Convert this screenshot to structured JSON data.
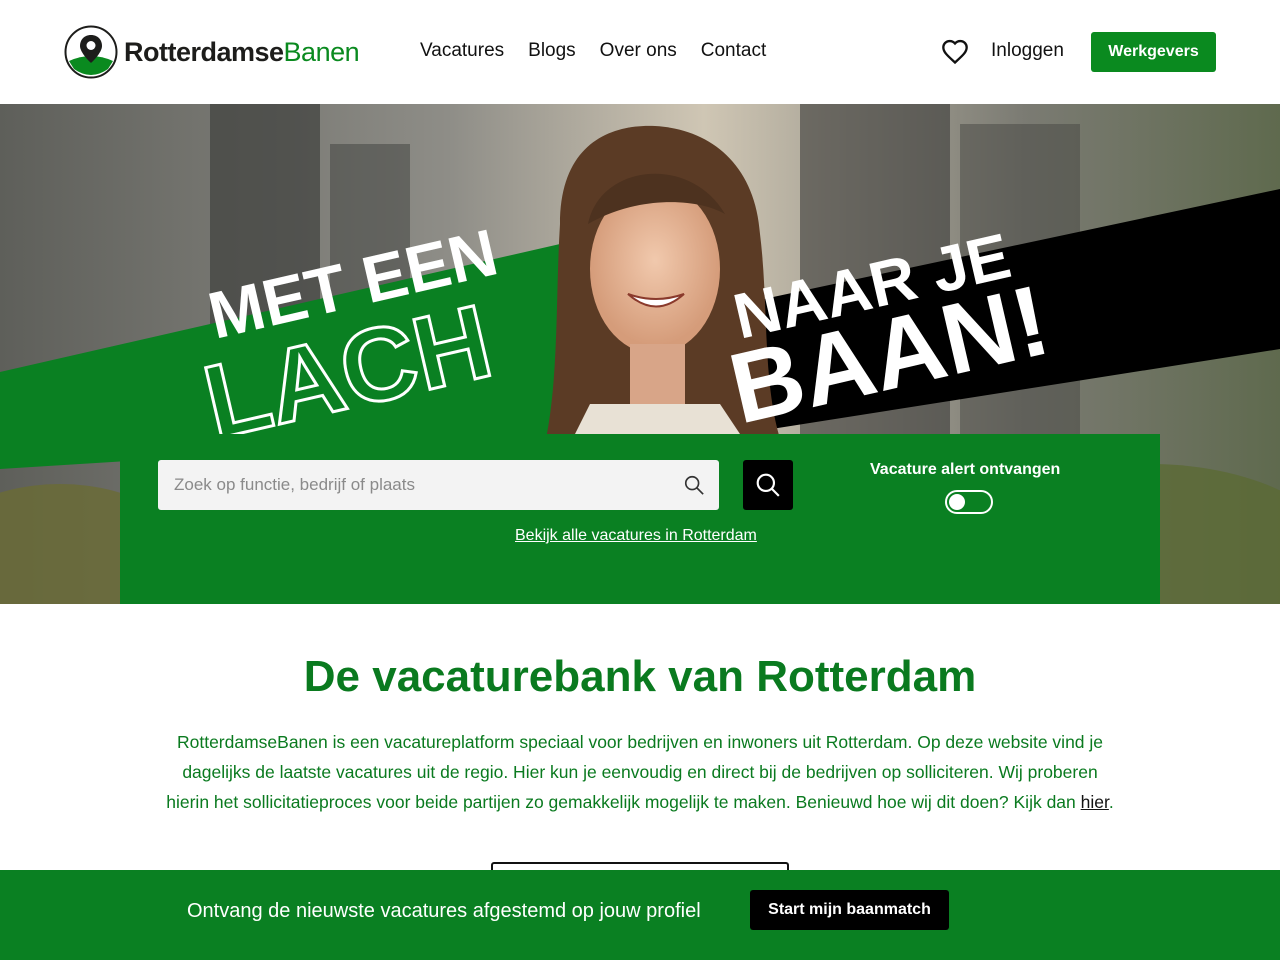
{
  "header": {
    "logo_part1": "Rotterdamse",
    "logo_part2": "Banen",
    "nav": [
      "Vacatures",
      "Blogs",
      "Over ons",
      "Contact"
    ],
    "login_label": "Inloggen",
    "employers_label": "Werkgevers"
  },
  "hero": {
    "slogan_line1": "MET EEN",
    "slogan_line2": "LACH",
    "slogan_line3": "NAAR JE",
    "slogan_line4": "BAAN!"
  },
  "search": {
    "placeholder": "Zoek op functie, bedrijf of plaats",
    "value": "",
    "all_link": "Bekijk alle vacatures in Rotterdam",
    "alert_label": "Vacature alert ontvangen",
    "alert_enabled": false
  },
  "intro": {
    "title": "De vacaturebank van Rotterdam",
    "text": "RotterdamseBanen is een vacatureplatform speciaal voor bedrijven en inwoners uit Rotterdam. Op deze website vind je dagelijks de laatste vacatures uit de regio. Hier kun je eenvoudig en direct bij de bedrijven op solliciteren. Wij proberen hierin het sollicitatieproces voor beide partijen zo gemakkelijk mogelijk te maken. Benieuwd hoe wij dit doen? Kijk dan ",
    "link": "hier",
    "text_end": "."
  },
  "bottom_bar": {
    "text": "Ontvang de nieuwste vacatures afgestemd op jouw profiel",
    "button": "Start mijn baanmatch"
  },
  "colors": {
    "brand_green": "#0a8022",
    "text_green": "#0a7a1f",
    "black": "#000000"
  }
}
